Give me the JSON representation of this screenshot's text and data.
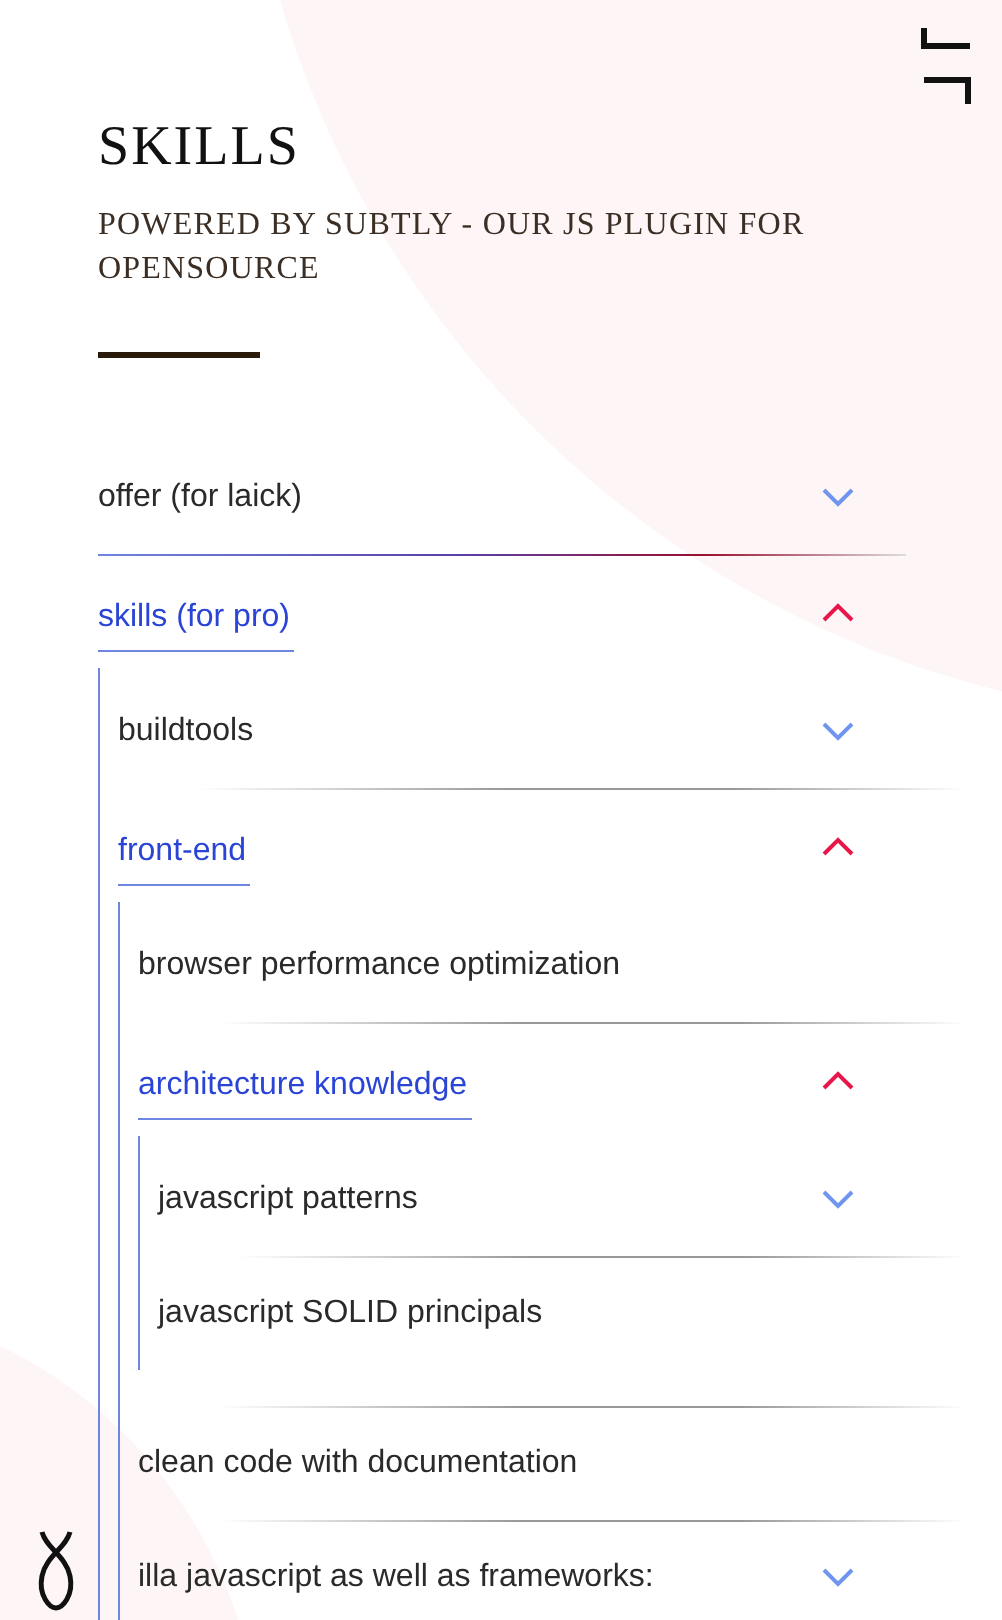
{
  "header": {
    "title": "SKILLS",
    "subtitle": "POWERED BY SUBTLY - OUR JS PLUGIN FOR OPENSOURCE"
  },
  "accordion": [
    {
      "kind": "group",
      "label": "offer (for laick)",
      "expanded": false
    },
    {
      "kind": "group",
      "label": "skills (for pro)",
      "expanded": true,
      "children": [
        {
          "kind": "group",
          "label": "buildtools",
          "expanded": false
        },
        {
          "kind": "group",
          "label": "front-end",
          "expanded": true,
          "children": [
            {
              "kind": "leaf",
              "label": "browser performance optimization"
            },
            {
              "kind": "group",
              "label": "architecture knowledge",
              "expanded": true,
              "children": [
                {
                  "kind": "group",
                  "label": "javascript patterns",
                  "expanded": false
                },
                {
                  "kind": "leaf",
                  "label": "javascript SOLID principals"
                }
              ]
            },
            {
              "kind": "leaf",
              "label": "clean code with documentation"
            },
            {
              "kind": "group",
              "label": "illa javascript as well as frameworks:",
              "expanded": false
            }
          ]
        }
      ]
    }
  ]
}
